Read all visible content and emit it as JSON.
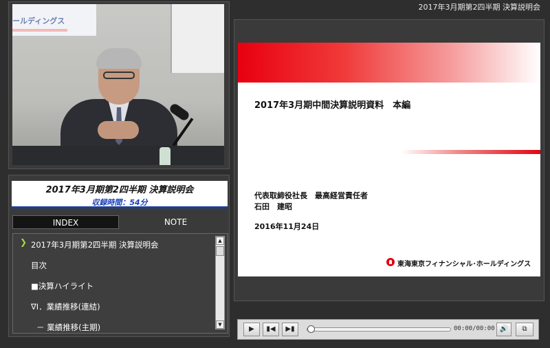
{
  "window_title": "2017年3月期第2四半期 決算説明会",
  "video": {
    "screen_text": "ールディングス"
  },
  "info": {
    "event_title": "2017年3月期第2四半期 決算説明会",
    "rec_label": "収録時間：",
    "rec_value": "54分"
  },
  "tabs": {
    "index": "INDEX",
    "note": "NOTE"
  },
  "index_items": [
    "2017年3月期第2四半期 決算説明会",
    "目次",
    "■決算ハイライト",
    "∇Ⅰ．業績推移(連結)",
    "－ 業績推移(主期)"
  ],
  "slide": {
    "title": "2017年3月期中間決算説明資料　本編",
    "presenter_role": "代表取締役社長　最高経営責任者",
    "presenter_name": "石田　建昭",
    "date": "2016年11月24日",
    "company": "東海東京フィナンシャル･ホールディングス",
    "accent_color": "#e30512"
  },
  "player": {
    "time": "00:00/00:00",
    "icons": [
      "play-icon",
      "previous-icon",
      "next-icon",
      "volume-icon",
      "fullscreen-icon"
    ]
  }
}
